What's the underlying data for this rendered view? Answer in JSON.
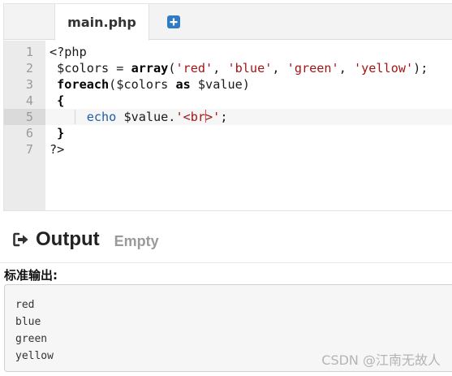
{
  "editor": {
    "active_tab": "main.php",
    "add_tab_icon": "plus-square-icon",
    "active_line": 5,
    "lines": [
      {
        "num": "1",
        "segments": [
          {
            "t": "<?php",
            "c": "punc"
          }
        ]
      },
      {
        "num": "2",
        "segments": [
          {
            "t": " $colors ",
            "c": "var"
          },
          {
            "t": "=",
            "c": "punc"
          },
          {
            "t": " ",
            "c": "punc"
          },
          {
            "t": "array",
            "c": "kw"
          },
          {
            "t": "(",
            "c": "punc"
          },
          {
            "t": "'red'",
            "c": "str"
          },
          {
            "t": ", ",
            "c": "punc"
          },
          {
            "t": "'blue'",
            "c": "str"
          },
          {
            "t": ", ",
            "c": "punc"
          },
          {
            "t": "'green'",
            "c": "str"
          },
          {
            "t": ", ",
            "c": "punc"
          },
          {
            "t": "'yellow'",
            "c": "str"
          },
          {
            "t": ");",
            "c": "punc"
          }
        ]
      },
      {
        "num": "3",
        "segments": [
          {
            "t": " ",
            "c": "punc"
          },
          {
            "t": "foreach",
            "c": "kw"
          },
          {
            "t": "($colors ",
            "c": "var"
          },
          {
            "t": "as",
            "c": "kw"
          },
          {
            "t": " $value)",
            "c": "var"
          }
        ]
      },
      {
        "num": "4",
        "segments": [
          {
            "t": " {",
            "c": "kw"
          }
        ]
      },
      {
        "num": "5",
        "segments": [
          {
            "t": "     ",
            "c": "punc"
          },
          {
            "t": "echo",
            "c": "fn"
          },
          {
            "t": " $value.",
            "c": "var"
          },
          {
            "t": "'<br",
            "c": "str"
          },
          {
            "t": "|cursor|",
            "c": "cursor"
          },
          {
            "t": ">'",
            "c": "str"
          },
          {
            "t": ";",
            "c": "punc"
          }
        ]
      },
      {
        "num": "6",
        "segments": [
          {
            "t": " }",
            "c": "kw"
          }
        ]
      },
      {
        "num": "7",
        "segments": [
          {
            "t": "?>",
            "c": "punc"
          }
        ]
      }
    ]
  },
  "output": {
    "icon": "sign-out-arrow-icon",
    "title": "Output",
    "status": "Empty",
    "stdout_label": "标准输出:",
    "stdout_lines": [
      "red",
      "blue",
      "green",
      "yellow"
    ]
  },
  "watermark": "CSDN @江南无故人"
}
